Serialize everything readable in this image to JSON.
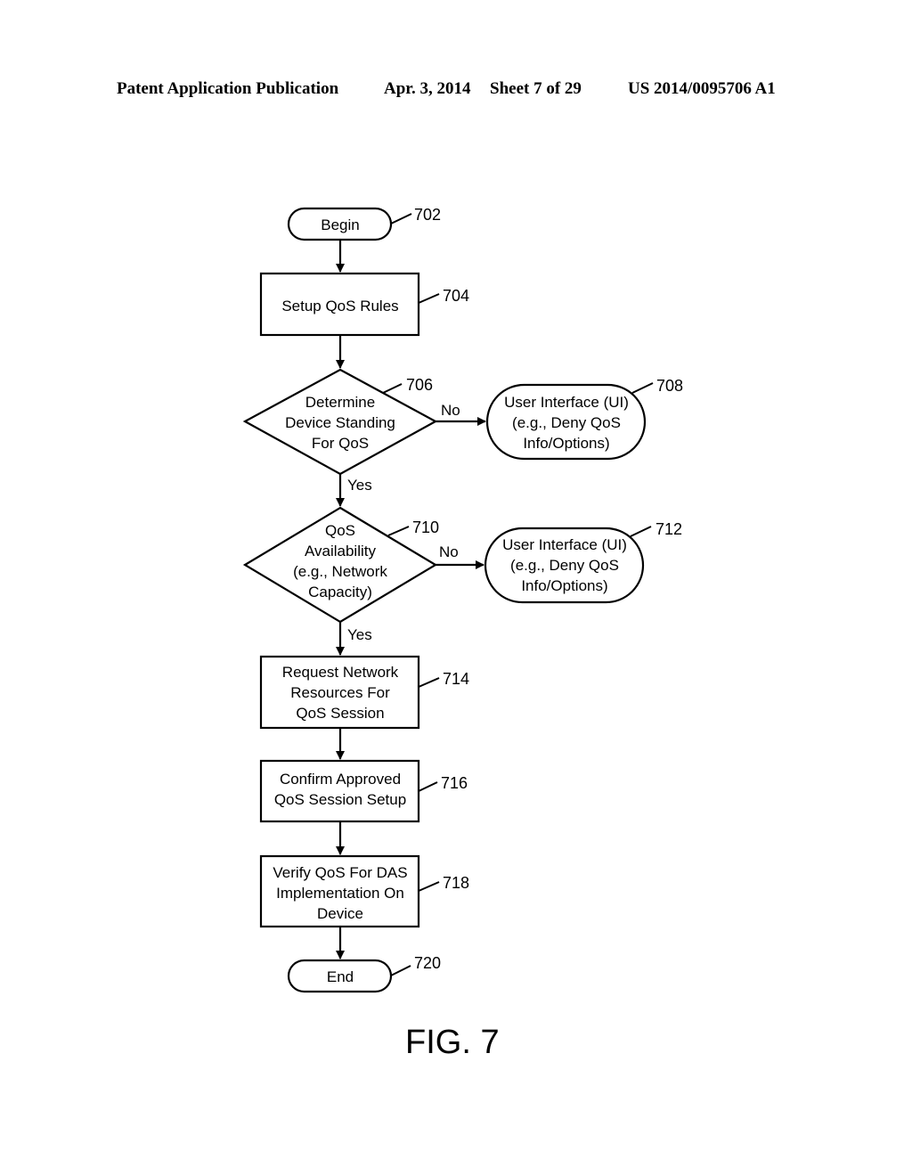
{
  "header": {
    "publication": "Patent Application Publication",
    "date": "Apr. 3, 2014",
    "sheet": "Sheet 7 of 29",
    "number": "US 2014/0095706 A1"
  },
  "figure": {
    "label": "FIG. 7"
  },
  "nodes": {
    "n702": {
      "ref": "702",
      "type": "terminal",
      "lines": [
        "Begin"
      ]
    },
    "n704": {
      "ref": "704",
      "type": "process",
      "lines": [
        "Setup QoS Rules"
      ]
    },
    "n706": {
      "ref": "706",
      "type": "decision",
      "lines": [
        "Determine",
        "Device Standing",
        "For QoS"
      ]
    },
    "n708": {
      "ref": "708",
      "type": "terminal",
      "lines": [
        "User Interface (UI)",
        "(e.g., Deny QoS",
        "Info/Options)"
      ]
    },
    "n710": {
      "ref": "710",
      "type": "decision",
      "lines": [
        "QoS",
        "Availability",
        "(e.g., Network",
        "Capacity)"
      ]
    },
    "n712": {
      "ref": "712",
      "type": "terminal",
      "lines": [
        "User Interface (UI)",
        "(e.g., Deny QoS",
        "Info/Options)"
      ]
    },
    "n714": {
      "ref": "714",
      "type": "process",
      "lines": [
        "Request Network",
        "Resources For",
        "QoS Session"
      ]
    },
    "n716": {
      "ref": "716",
      "type": "process",
      "lines": [
        "Confirm Approved",
        "QoS Session Setup"
      ]
    },
    "n718": {
      "ref": "718",
      "type": "process",
      "lines": [
        "Verify QoS For DAS",
        "Implementation On",
        "Device"
      ]
    },
    "n720": {
      "ref": "720",
      "type": "terminal",
      "lines": [
        "End"
      ]
    }
  },
  "edges": {
    "e706_no": {
      "from": "706",
      "to": "708",
      "label": "No"
    },
    "e706_yes": {
      "from": "706",
      "to": "710",
      "label": "Yes"
    },
    "e710_no": {
      "from": "710",
      "to": "712",
      "label": "No"
    },
    "e710_yes": {
      "from": "710",
      "to": "714",
      "label": "Yes"
    }
  }
}
